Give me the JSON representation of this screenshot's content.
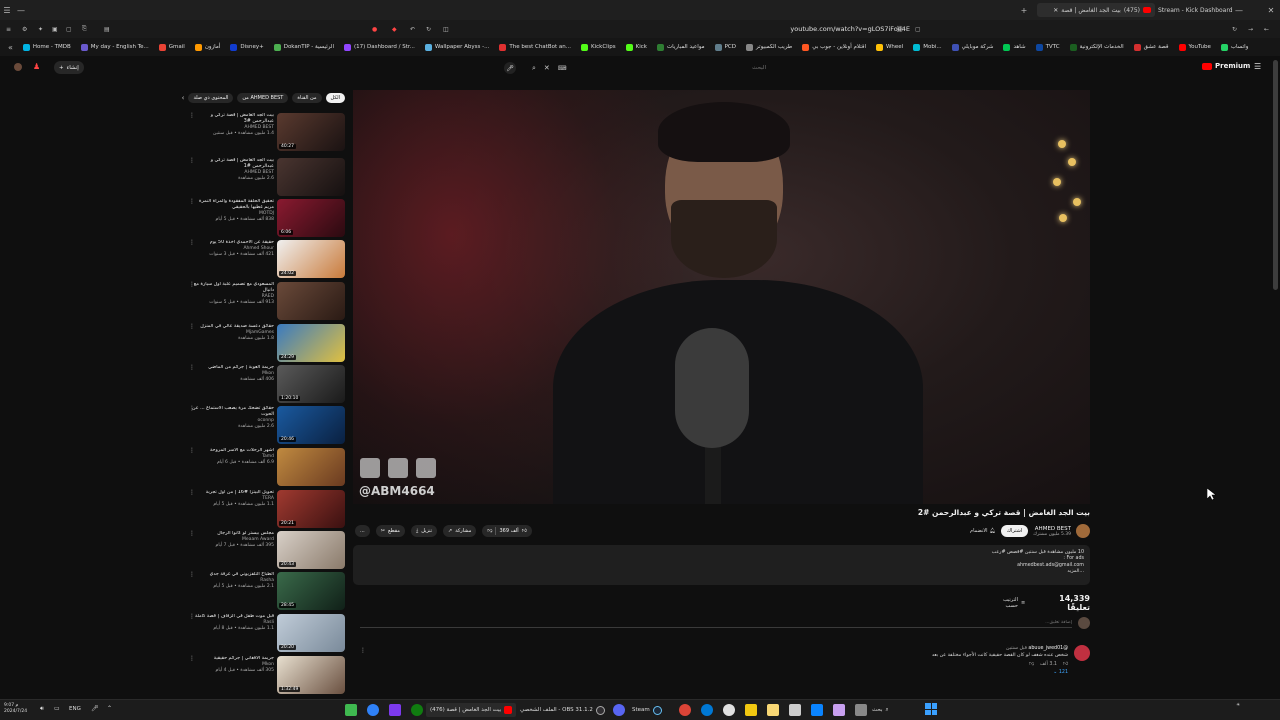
{
  "browser": {
    "tabs": [
      {
        "label": "بيت الجد الغامض | قصة",
        "count": "(475)"
      },
      {
        "label": "Stream - Kick Dashboard"
      }
    ],
    "url": "youtube.com/watch?v=gLOS7iFoe4E"
  },
  "bookmarks": [
    {
      "label": "Home - TMDB",
      "color": "#01b4e4"
    },
    {
      "label": "My day - English Te...",
      "color": "#6a5acd"
    },
    {
      "label": "Gmail",
      "color": "#ea4335"
    },
    {
      "label": "أمازون",
      "color": "#ff9900"
    },
    {
      "label": "Disney+",
      "color": "#113ccf"
    },
    {
      "label": "DokanTIP - الرئيسية",
      "color": "#4caf50"
    },
    {
      "label": "(17) Dashboard / Str...",
      "color": "#9146ff"
    },
    {
      "label": "Wallpaper Abyss -...",
      "color": "#5ab0e0"
    },
    {
      "label": "The best ChatBot an...",
      "color": "#e03030"
    },
    {
      "label": "KickClips",
      "color": "#53fc18"
    },
    {
      "label": "Kick",
      "color": "#53fc18"
    },
    {
      "label": "مواعيد المباريات",
      "color": "#2e7d32"
    },
    {
      "label": "PCD",
      "color": "#607d8b"
    },
    {
      "label": "طريب الكمبيوتر",
      "color": "#888888"
    },
    {
      "label": "اقتلام أونلاين - جوب بي",
      "color": "#ff5722"
    },
    {
      "label": "Wheel",
      "color": "#ffc107"
    },
    {
      "label": "Mobi...",
      "color": "#00bcd4"
    },
    {
      "label": "شركة موبايلي",
      "color": "#3f51b5"
    },
    {
      "label": "شاهد",
      "color": "#00c853"
    },
    {
      "label": "TVTC",
      "color": "#0d47a1"
    },
    {
      "label": "الخدمات الإلكترونية",
      "color": "#1b5e20"
    },
    {
      "label": "قصة عشق",
      "color": "#d32f2f"
    },
    {
      "label": "YouTube",
      "color": "#ff0000"
    },
    {
      "label": "واتساب",
      "color": "#25d366"
    }
  ],
  "youtube": {
    "logo": "Premium",
    "search_placeholder": "البحث",
    "search_value": "",
    "create_label": "إنشاء"
  },
  "sidebar": {
    "chips": [
      {
        "label": "الكل",
        "active": true
      },
      {
        "label": "من القناة",
        "active": false
      },
      {
        "label": "من AHMED BEST",
        "active": false
      },
      {
        "label": "المحتوى ذي صلة",
        "active": false
      }
    ],
    "items": [
      {
        "title": "بيت الجد الغامض | قصة تركي و عبدالرحمن #3",
        "channel": "AHMED BEST",
        "stats": "1.4 مليون مشاهدة • قبل سنتين",
        "duration": "40:27",
        "color": "#5a3a2f"
      },
      {
        "title": "بيت الجد الغامض | قصة تركي و عبدالرحمن #1",
        "channel": "AHMED BEST",
        "stats": "2.6 مليون مشاهدة",
        "duration": "",
        "color": "#4a3530"
      },
      {
        "title": "تحقيق الحلقة المفقودة والمرأة النمرة مريم غطيها بالحقيقي",
        "channel": "MOTDJ",
        "stats": "838 ألف مشاهدة • قبل 5 أيام",
        "duration": "6:06",
        "color": "#8a1a30"
      },
      {
        "title": "حقيقة عن الأحمدي اخذة 50 يوم",
        "channel": "Ahmed Shour",
        "stats": "421 ألف مشاهدة • قبل 3 سنوات",
        "duration": "24:02",
        "color": "#c97a3a"
      },
      {
        "title": "المسعودي مع تصميم علبة أول سيارة مع دانيال",
        "channel": "RAED",
        "stats": "913 ألف مشاهدة • قبل 5 سنوات",
        "duration": "",
        "color": "#6a4a3a"
      },
      {
        "title": "حقائق دعسة صديقة عالي في المنزل",
        "channel": "MjamGames",
        "stats": "1.8 مليون مشاهدة",
        "duration": "24:29",
        "color": "#3a7ac0"
      },
      {
        "title": "جريمة العوبة | جرائم من الماضي",
        "channel": "Mkon",
        "stats": "406 ألف مشاهدة",
        "duration": "1:20:10",
        "color": "#5a5a5a"
      },
      {
        "title": "حقائق تضحك مرة يصعب الاستماع ... عن الحوت",
        "channel": "oconnp",
        "stats": "2.6 مليون مشاهدة",
        "duration": "20:46",
        "color": "#1a5aa0"
      },
      {
        "title": "أشهر الرحلات مع الأسر المروحة",
        "channel": "Tamd",
        "stats": "6.9 ألف مشاهدة • قبل 6 أيام",
        "duration": "",
        "color": "#c08a40"
      },
      {
        "title": "تحويل البيتزا #16 | من أول تجربة",
        "channel": "TERA",
        "stats": "1.1 مليون مشاهدة • قبل 5 أيام",
        "duration": "20:21",
        "color": "#a03a30"
      },
      {
        "title": "مجلس بيستر لو كانوا الرجال",
        "channel": "Meaam Award",
        "stats": "395 ألف مشاهدة • قبل 7 أيام",
        "duration": "20:43",
        "color": "#8a7a6a"
      },
      {
        "title": "الطباخ التلفزيوني في غرفة جدي",
        "channel": "Rasha",
        "stats": "2.1 مليون مشاهدة • قبل 5 أيام",
        "duration": "28:45",
        "color": "#3a6a4a"
      },
      {
        "title": "قبل موت طفل في الزفاف | قصة كاملة",
        "channel": "Rasli",
        "stats": "1.1 مليون مشاهدة • قبل 8 أيام",
        "duration": "20:20",
        "color": "#7a8a9a"
      },
      {
        "title": "جريمة الأفغاني | جرائم حقيقية",
        "channel": "Mkon",
        "stats": "305 ألف مشاهدة • قبل 4 أيام",
        "duration": "1:32:49",
        "color": "#6a5040"
      }
    ]
  },
  "video": {
    "handle": "@ABM4664",
    "title": "بيت الجد الغامض | قصة تركي و عبدالرحمن #2",
    "channel": "AHMED BEST",
    "subscribers": "5.39 مليون مشترك",
    "subscribe_label": "اشتراك",
    "join_label": "الانضمام",
    "likes": "369 ألف",
    "share_label": "مشاركة",
    "download_label": "تنزيل",
    "clip_label": "مقطع",
    "more_label": "..."
  },
  "description": {
    "lines": [
      "10 مليون مشاهدة قبل سنتين #قصص #رعب",
      "For ads :",
      "ahmedbest.ads@gmail.com",
      "...المزيد"
    ]
  },
  "comments": {
    "count": "14,339 تعليقًا",
    "sort_label": "الترتيب حسب",
    "add_placeholder": "إضافة تعليق...",
    "first": {
      "author": "@abuue_jwed01",
      "time": "قبل سنتين",
      "text": "شخص عنده شغف لو كان القصة حقيقية كانت الأجواء مختلفة عن بعد",
      "likes": "3.1 ألف",
      "replies": "121"
    }
  },
  "taskbar": {
    "search_label": "بحث",
    "time": "9:07 م",
    "date": "2024/7/24",
    "lang": "ENG",
    "items": [
      {
        "label": "(476) بيت الجد الغامض | قصة",
        "color": "#ff0000"
      },
      {
        "label": "الملف الشخصي - OBS 31.1.2",
        "color": "#302e31"
      },
      {
        "label": "Steam",
        "color": "#1b2838"
      }
    ]
  }
}
